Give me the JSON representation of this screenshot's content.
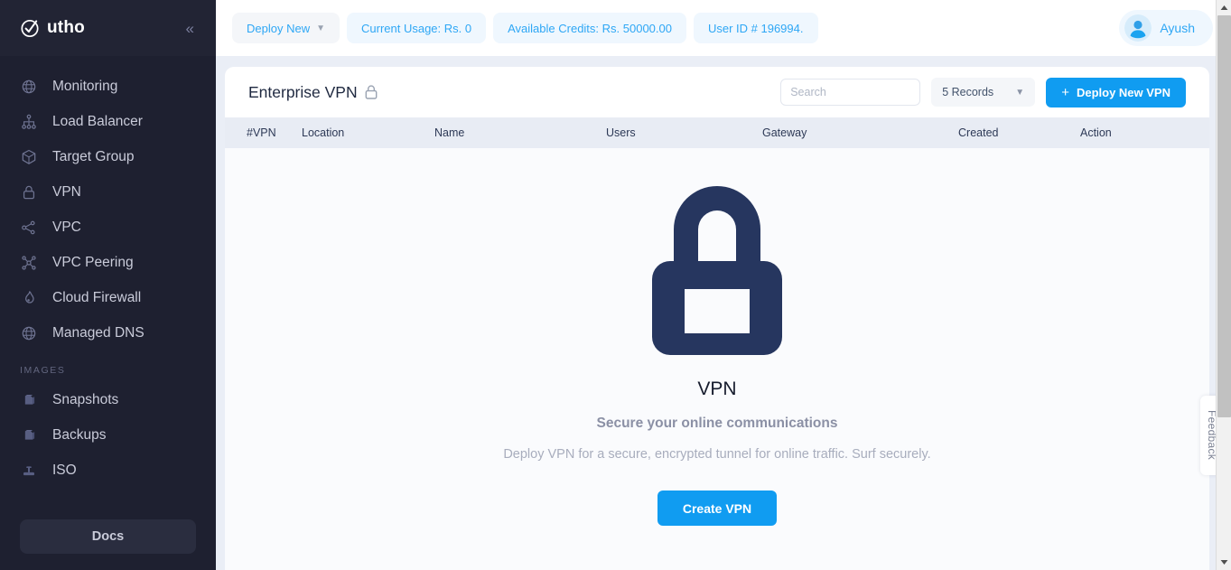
{
  "sidebar": {
    "logo_text": "utho",
    "collapse_label": "«",
    "items": [
      {
        "label": "Monitoring",
        "icon": "globe-grid-icon"
      },
      {
        "label": "Load Balancer",
        "icon": "hierarchy-icon"
      },
      {
        "label": "Target Group",
        "icon": "cube-icon"
      },
      {
        "label": "VPN",
        "icon": "lock-icon"
      },
      {
        "label": "VPC",
        "icon": "share-nodes-icon"
      },
      {
        "label": "VPC Peering",
        "icon": "network-nodes-icon"
      },
      {
        "label": "Cloud Firewall",
        "icon": "flame-icon"
      },
      {
        "label": "Managed DNS",
        "icon": "globe-grid-icon"
      }
    ],
    "section_images_label": "IMAGES",
    "image_items": [
      {
        "label": "Snapshots",
        "icon": "box-icon"
      },
      {
        "label": "Backups",
        "icon": "box-icon"
      },
      {
        "label": "ISO",
        "icon": "disc-drive-icon"
      }
    ],
    "docs_label": "Docs"
  },
  "topbar": {
    "deploy_new_label": "Deploy New",
    "pills": [
      "Current Usage: Rs. 0",
      "Available Credits: Rs. 50000.00",
      "User ID # 196994."
    ],
    "user_name": "Ayush"
  },
  "card": {
    "title": "Enterprise VPN",
    "title_icon": "lock-icon",
    "search_placeholder": "Search",
    "search_value": "",
    "records_label": "5 Records",
    "deploy_button_label": "Deploy New VPN",
    "columns": [
      "#VPN",
      "Location",
      "Name",
      "Users",
      "Gateway",
      "Created",
      "Action"
    ]
  },
  "empty_state": {
    "illustration": "padlock-illustration",
    "title": "VPN",
    "subtitle": "Secure your online communications",
    "description": "Deploy VPN for a secure, encrypted tunnel for online traffic. Surf securely.",
    "button_label": "Create VPN"
  },
  "feedback": {
    "label": "Feedback"
  },
  "colors": {
    "accent_blue": "#109cf1",
    "link_blue": "#2ea7f5",
    "sidebar_bg": "#1e2030",
    "page_bg": "#eaeef6",
    "lock_navy": "#26365f"
  }
}
